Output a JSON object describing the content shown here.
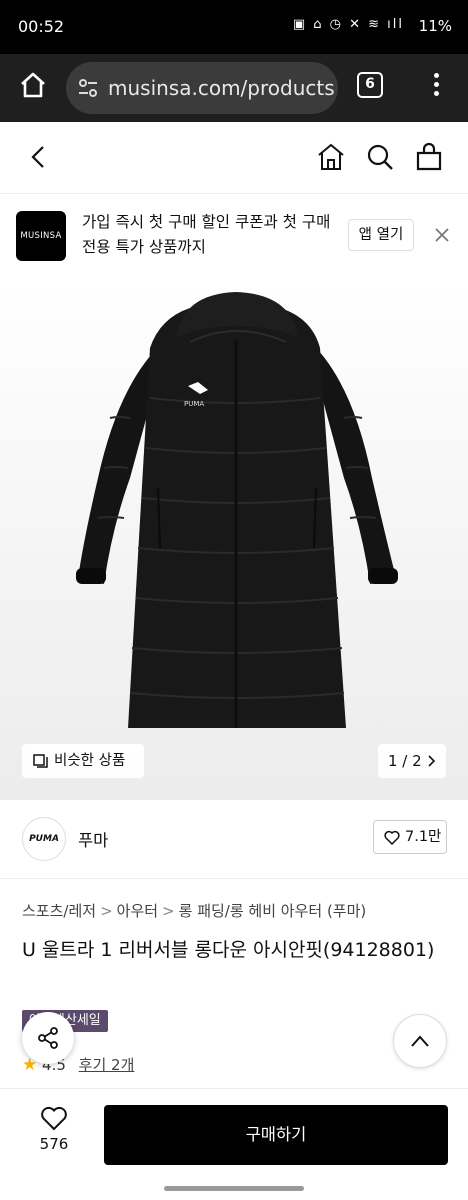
{
  "status_bar": {
    "time": "00:52",
    "icons": "▣ ⌂ ◷ ✕ ≋ ıll",
    "battery": "11%"
  },
  "browser": {
    "url": "musinsa.com/products",
    "tab_count": "6"
  },
  "banner": {
    "logo_text": "MUSINSA",
    "message": "가입 즉시 첫 구매 할인 쿠폰과 첫 구매 전용 특가 상품까지",
    "open_label": "앱 열기"
  },
  "gallery": {
    "similar_label": "비슷한 상품",
    "page_indicator": "1 / 2",
    "coat_logo": "PUMA"
  },
  "brand": {
    "logo_text": "PUMA",
    "name": "푸마",
    "likes": "7.1만"
  },
  "breadcrumb": [
    "스포츠/레저",
    "아우터",
    "롱 패딩/롱 헤비 아우터 (푸마)"
  ],
  "breadcrumb_sep": ">",
  "product": {
    "title": "U 울트라 1 리버서블 롱다운 아시안핏(94128801)",
    "sale_tag": "아울렛산세일",
    "rating": "4.5",
    "reviews": "후기 2개"
  },
  "bottom_bar": {
    "wish_count": "576",
    "buy_label": "구매하기"
  },
  "colors": {
    "buy_button": "#000000",
    "sale_tag": "#5b4a6b",
    "star": "#f5b400"
  }
}
